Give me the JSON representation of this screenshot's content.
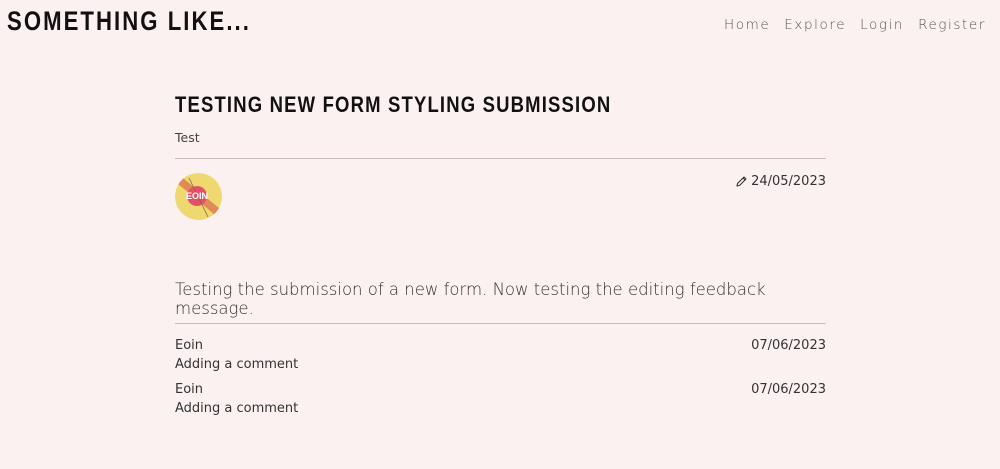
{
  "brand": "SOMETHING LIKE...",
  "nav": {
    "home": "Home",
    "explore": "Explore",
    "login": "Login",
    "register": "Register"
  },
  "post": {
    "title": "TESTING NEW FORM STYLING SUBMISSION",
    "subtitle": "Test",
    "avatar_text": "EOIN",
    "date_icon": "pencil-icon",
    "date": "24/05/2023",
    "body": "Testing the submission of a new form. Now testing the editing feedback message."
  },
  "comments": [
    {
      "author": "Eoin",
      "date": "07/06/2023",
      "text": "Adding a comment"
    },
    {
      "author": "Eoin",
      "date": "07/06/2023",
      "text": "Adding a comment"
    }
  ],
  "colors": {
    "background": "#fbf1f0",
    "avatar_yellow": "#efd870",
    "avatar_stripe": "#e08a55",
    "avatar_red": "#e2506a"
  }
}
